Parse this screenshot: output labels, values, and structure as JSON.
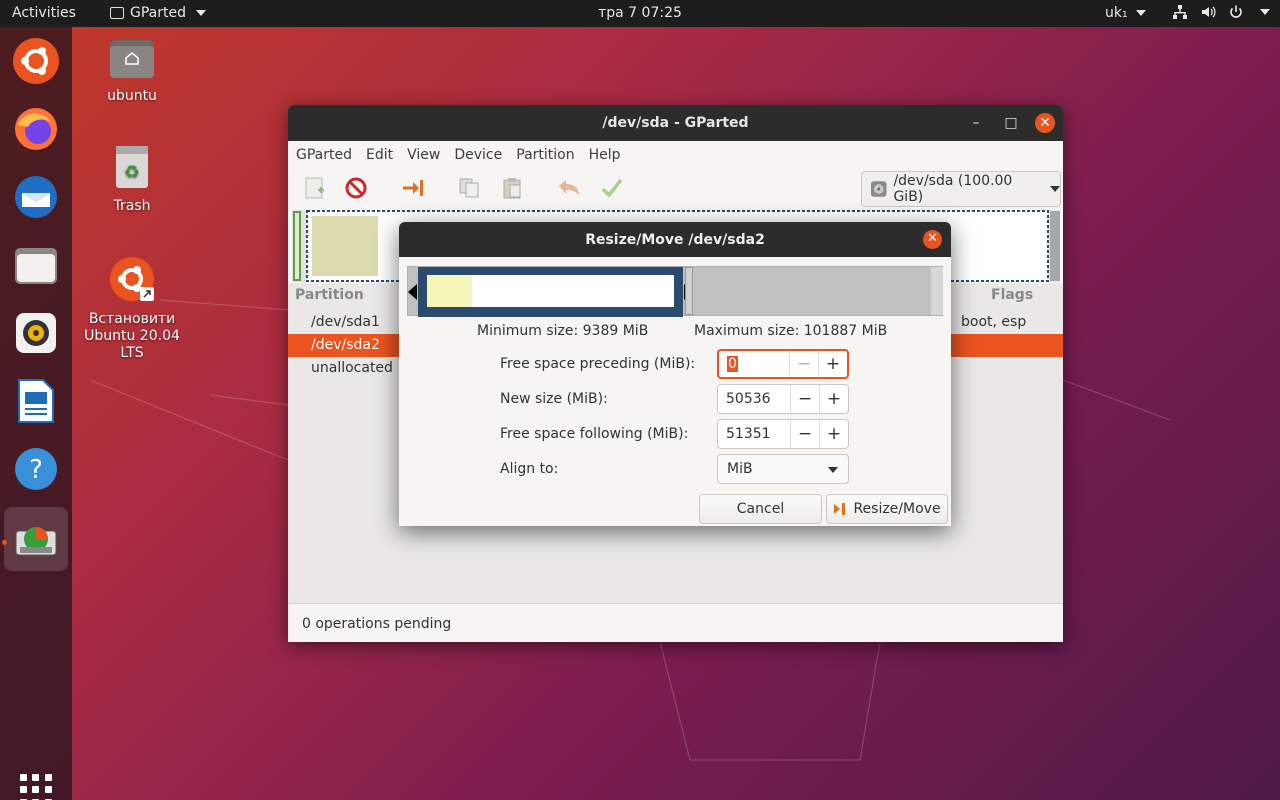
{
  "topbar": {
    "activities": "Activities",
    "app_name": "GParted",
    "clock": "тра 7  07:25",
    "keyboard": "uk₁"
  },
  "desktop": {
    "home_label": "ubuntu",
    "trash_label": "Trash",
    "install_label_1": "Встановити",
    "install_label_2": "Ubuntu 20.04",
    "install_label_3": "LTS"
  },
  "gparted": {
    "title": "/dev/sda - GParted",
    "menu": [
      "GParted",
      "Edit",
      "View",
      "Device",
      "Partition",
      "Help"
    ],
    "device": "/dev/sda (100.00 GiB)",
    "columns": {
      "partition": "Partition",
      "flags": "Flags"
    },
    "rows": [
      {
        "name": "/dev/sda1",
        "flags": "boot, esp"
      },
      {
        "name": "/dev/sda2",
        "flags": ""
      },
      {
        "name": "unallocated",
        "flags": ""
      }
    ],
    "status": "0 operations pending"
  },
  "dialog": {
    "title": "Resize/Move /dev/sda2",
    "min_size": "Minimum size: 9389 MiB",
    "max_size": "Maximum size: 101887 MiB",
    "preceding_label": "Free space preceding (MiB):",
    "preceding_value": "0",
    "new_size_label": "New size (MiB):",
    "new_size_value": "50536",
    "following_label": "Free space following (MiB):",
    "following_value": "51351",
    "align_label": "Align to:",
    "align_value": "MiB",
    "cancel": "Cancel",
    "resize_move": "Resize/Move"
  },
  "colors": {
    "accent": "#e95420",
    "titlebar": "#2c2c2c",
    "partition_border": "#2a4a6e",
    "used_space": "#f5f5b8"
  }
}
